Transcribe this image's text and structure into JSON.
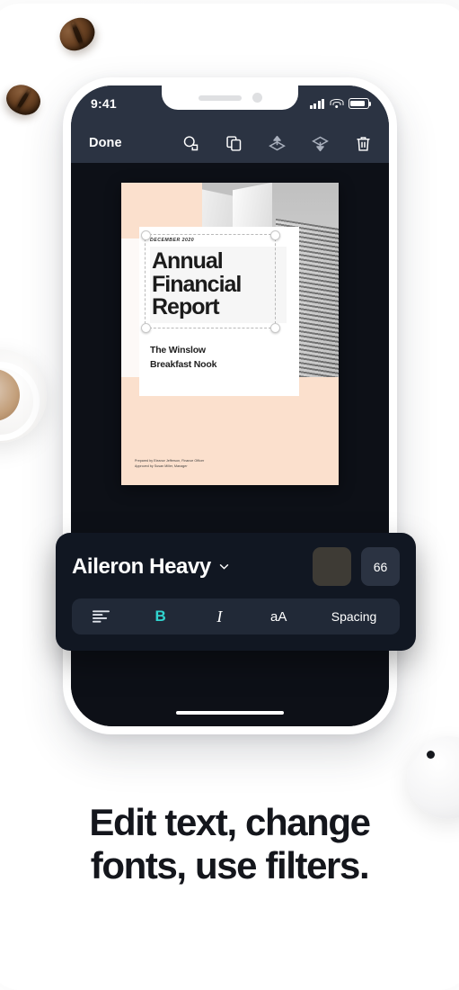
{
  "phone": {
    "status_bar": {
      "time": "9:41",
      "icons": [
        "cellular-signal-icon",
        "wifi-icon",
        "battery-icon"
      ]
    },
    "toolbar": {
      "done_label": "Done",
      "actions": [
        {
          "name": "magic-select-icon",
          "label": "Magic Select"
        },
        {
          "name": "duplicate-icon",
          "label": "Duplicate"
        },
        {
          "name": "bring-forward-icon",
          "label": "Bring Forward"
        },
        {
          "name": "send-backward-icon",
          "label": "Send Backward"
        },
        {
          "name": "delete-icon",
          "label": "Delete"
        }
      ]
    },
    "document": {
      "date": "DECEMBER 2020",
      "title": "Annual Financial Report",
      "subtitle_line1": "The Winslow",
      "subtitle_line2": "Breakfast Nook",
      "footer_line1": "Prepared by Eleanor Jefferson, Finance Officer",
      "footer_line2": "Approved by Susan Miller, Manager"
    },
    "font_panel": {
      "font_name": "Aileron Heavy",
      "dropdown_icon": "chevron-down-icon",
      "color_swatch": "#3e3b35",
      "font_size": "66",
      "tools": [
        {
          "name": "align-left-icon",
          "label": "",
          "active": false
        },
        {
          "name": "bold-button",
          "label": "B",
          "active": true
        },
        {
          "name": "italic-button",
          "label": "I",
          "active": false
        },
        {
          "name": "text-case-button",
          "label": "aA",
          "active": false
        },
        {
          "name": "spacing-button",
          "label": "Spacing",
          "active": false
        }
      ]
    }
  },
  "headline": {
    "line1": "Edit text, change",
    "line2": "fonts, use filters."
  },
  "colors": {
    "accent": "#31d4cf",
    "toolbar_bg": "#2b3342",
    "screen_bg": "#0d1017",
    "panel_bg": "#111722",
    "peach": "#fbe0cd",
    "headline": "#14161c"
  }
}
